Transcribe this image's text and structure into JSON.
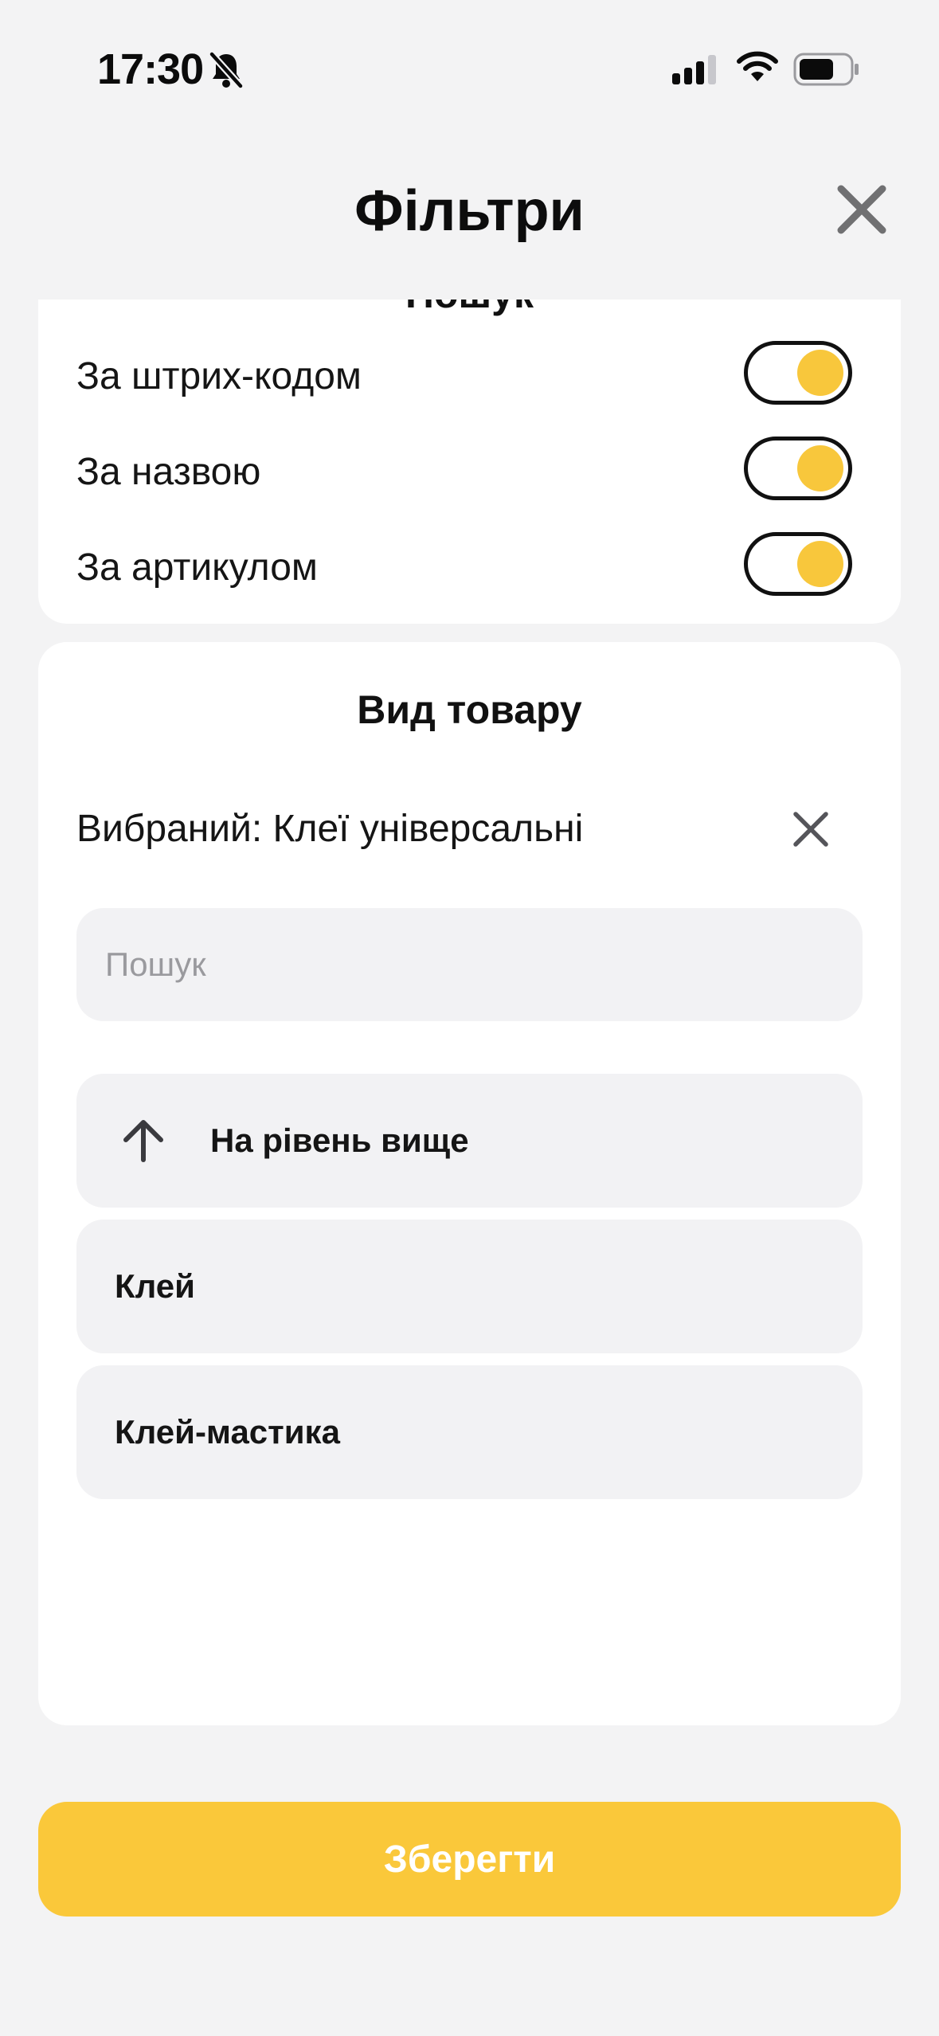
{
  "status_bar": {
    "time": "17:30"
  },
  "header": {
    "title": "Фільтри"
  },
  "search_section": {
    "title": "Пошук",
    "toggles": [
      {
        "label": "За штрих-кодом",
        "on": true
      },
      {
        "label": "За назвою",
        "on": true
      },
      {
        "label": "За артикулом",
        "on": true
      }
    ]
  },
  "product_type": {
    "title": "Вид товару",
    "selected_text": "Вибраний: Клеї універсальні",
    "search_placeholder": "Пошук",
    "search_value": "",
    "items": [
      {
        "label": "На рівень вище",
        "icon": "up-arrow-icon"
      },
      {
        "label": "Клей"
      },
      {
        "label": "Клей-мастика"
      }
    ]
  },
  "footer": {
    "save_label": "Зберегти"
  },
  "colors": {
    "accent": "#fac83a",
    "background": "#f3f3f4",
    "card": "#ffffff",
    "field": "#f2f2f4"
  }
}
